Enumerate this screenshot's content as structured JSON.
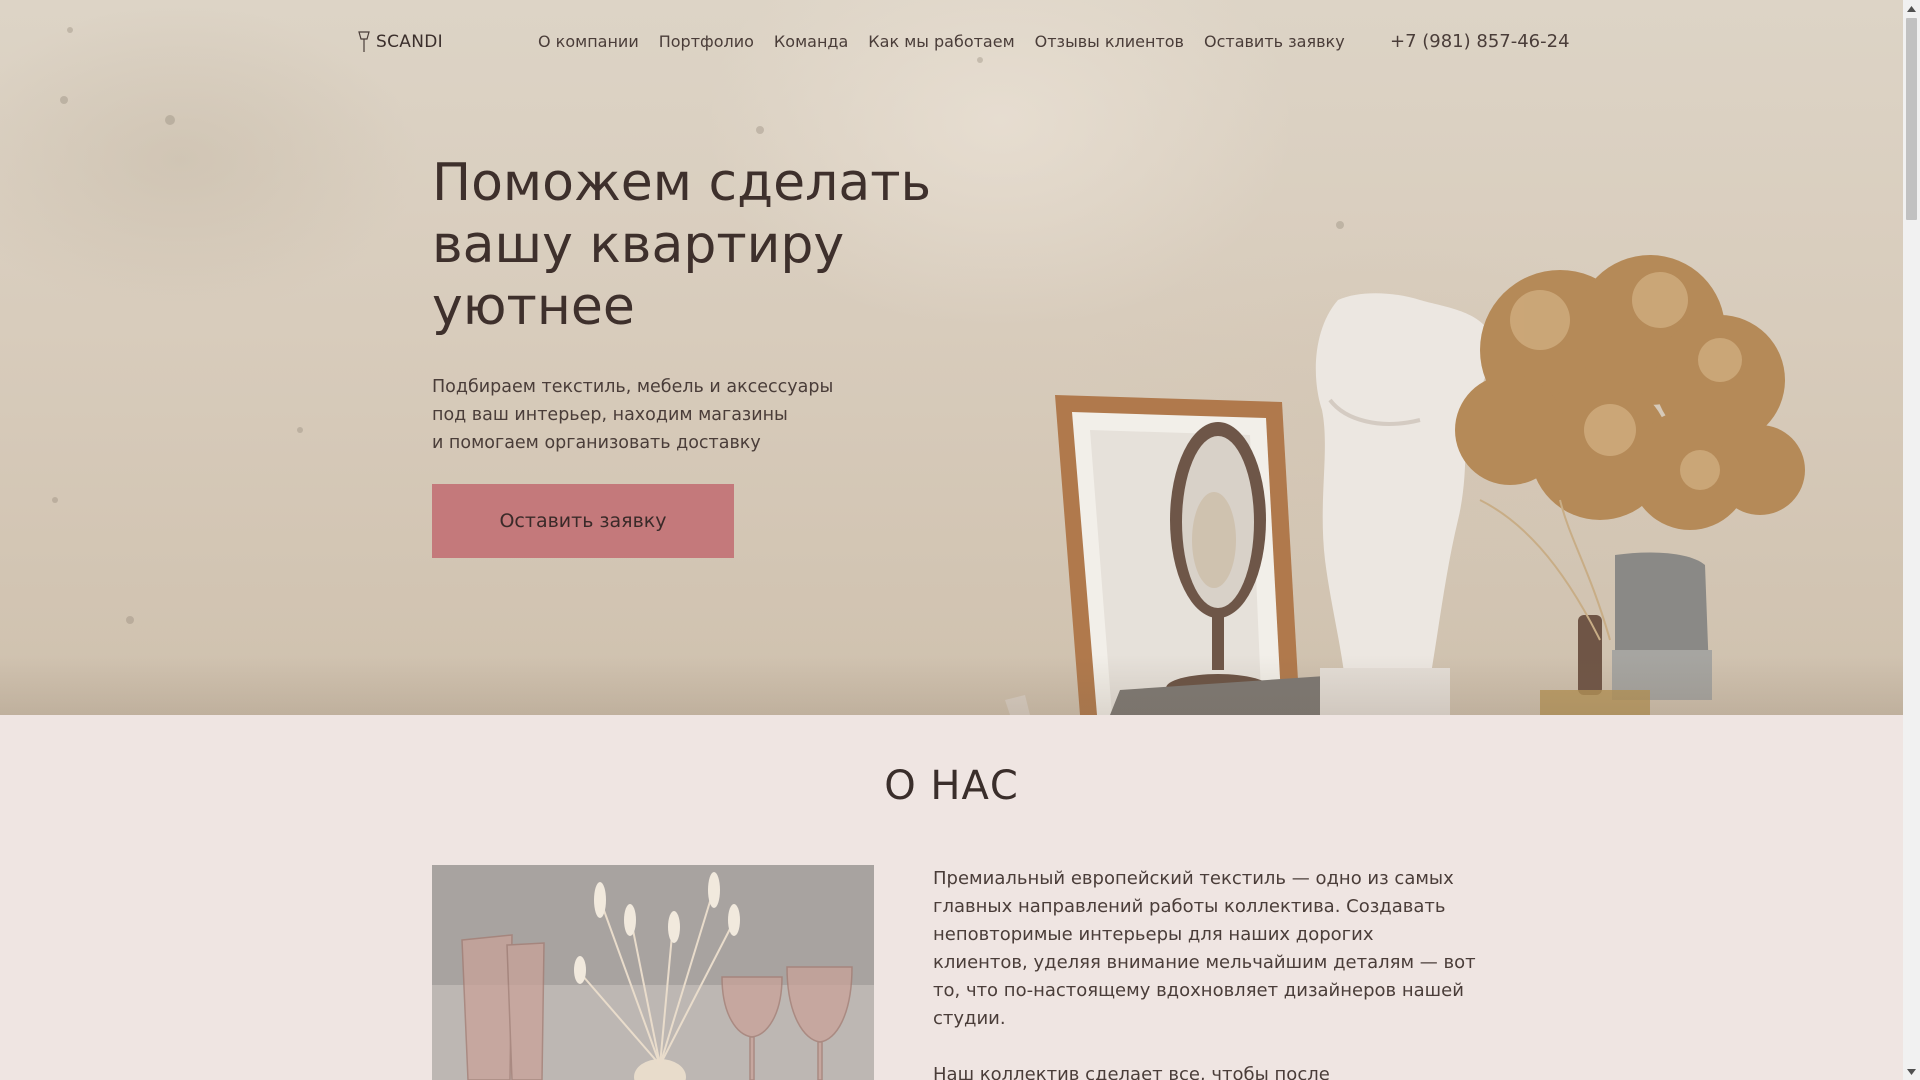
{
  "brand": {
    "logo_text": "SCANDI",
    "accent_color": "#c4797b"
  },
  "nav": {
    "items": [
      {
        "label": "О компании"
      },
      {
        "label": "Портфолио"
      },
      {
        "label": "Команда"
      },
      {
        "label": "Как мы работаем"
      },
      {
        "label": "Отзывы клиентов"
      },
      {
        "label": "Оставить заявку"
      }
    ],
    "phone": "+7 (981) 857-46-24"
  },
  "hero": {
    "title": "Поможем сделать вашу квартиру уютнее",
    "subtitle_lines": [
      "Подбираем текстиль, мебель и аксессуары",
      "под ваш интерьер, находим магазины",
      "и помогаем организовать доставку"
    ],
    "cta_label": "Оставить заявку"
  },
  "about": {
    "title": "О НАС",
    "paragraph1_lines": [
      "Премиальный европейский текстиль — одно из самых",
      "главных направлений работы коллектива. Создавать",
      "неповторимые интерьеры для наших дорогих",
      "клиентов, уделяя внимание мельчайшим деталям — вот",
      "то, что по-настоящему вдохновляет дизайнеров нашей",
      "студии."
    ],
    "paragraph2_lines": [
      "Наш коллектив сделает все, чтобы после"
    ]
  }
}
